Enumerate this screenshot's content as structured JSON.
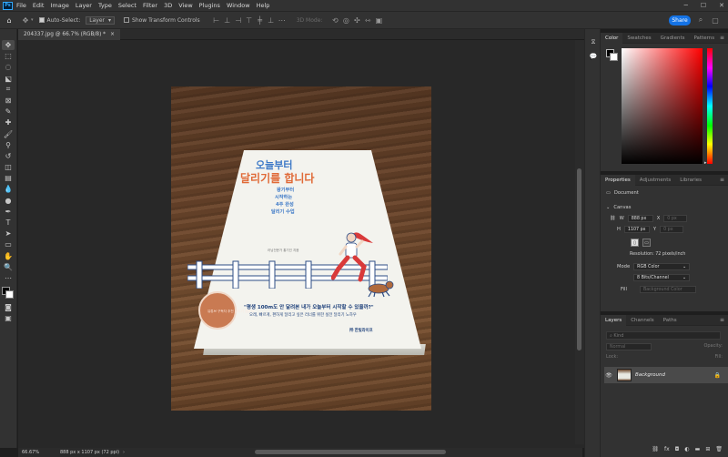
{
  "menu": {
    "logo": "Ps",
    "items": [
      "File",
      "Edit",
      "Image",
      "Layer",
      "Type",
      "Select",
      "Filter",
      "3D",
      "View",
      "Plugins",
      "Window",
      "Help"
    ]
  },
  "options": {
    "auto_select": "Auto-Select:",
    "auto_select_target": "Layer",
    "show_transform": "Show Transform Controls",
    "mode_3d": "3D Mode:",
    "share": "Share"
  },
  "document": {
    "tab_title": "204337.jpg @ 66.7% (RGB/8) *",
    "close": "×"
  },
  "book": {
    "title_line1": "오늘부터",
    "title_line2": "달리기를 합니다",
    "subtitle": [
      "왕기부터",
      "시작하는",
      "4주 완성",
      "달리기 수업"
    ],
    "author": "러닝전문가 홍기인 지음",
    "quote": "\"평생 100m도 안 달려본 내가 오늘부터 시작할 수 있을까?\"",
    "desc": "오래, 빠르게, 편하게 달리고 싶은 러너를 위한 실전 달리기 노하우",
    "publisher": "㈜ 한빛라이프",
    "badge": "유튜브 구독자 추천 달리기 입문서"
  },
  "panels": {
    "color_tabs": [
      "Color",
      "Swatches",
      "Gradients",
      "Patterns"
    ],
    "props_tabs": [
      "Properties",
      "Adjustments",
      "Libraries"
    ],
    "layers_tabs": [
      "Layers",
      "Channels",
      "Paths"
    ],
    "document_label": "Document",
    "canvas_label": "Canvas",
    "w_label": "W",
    "w_value": "888 px",
    "h_label": "H",
    "h_value": "1107 px",
    "x_label": "X",
    "x_value": "0 px",
    "y_label": "Y",
    "y_value": "0 px",
    "resolution": "Resolution: 72 pixels/inch",
    "mode_label": "Mode",
    "mode_value": "RGB Color",
    "bits_value": "8 Bits/Channel",
    "fill_label": "Fill",
    "fill_value": "Background Color",
    "kind_placeholder": "Kind",
    "blend": "Normal",
    "opacity": "Opacity:",
    "lock": "Lock:",
    "fill_short": "Fill:",
    "layer_name": "Background"
  },
  "status": {
    "zoom": "66.67%",
    "doc_size": "888 px x 1107 px (72 ppi)"
  }
}
